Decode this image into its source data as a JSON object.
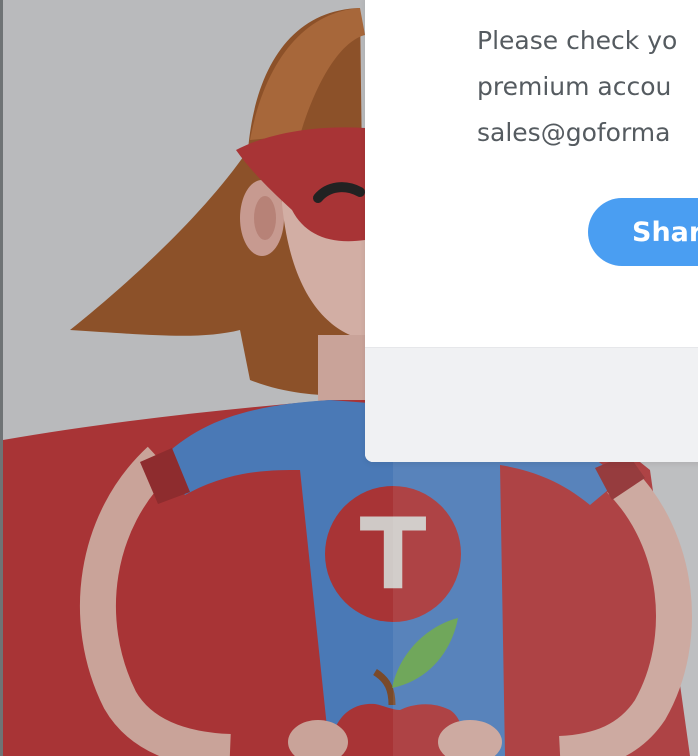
{
  "modal": {
    "lines": [
      "Please check yo",
      "premium accou",
      "sales@goforma"
    ],
    "share_button_label": "Shar"
  },
  "mascot": {
    "emblem_letter": "T"
  },
  "colors": {
    "backdrop": "#b9babc",
    "cape": "#a83436",
    "hair": "#8c5129",
    "suit": "#4a79b6",
    "button": "#4a9ef2"
  }
}
